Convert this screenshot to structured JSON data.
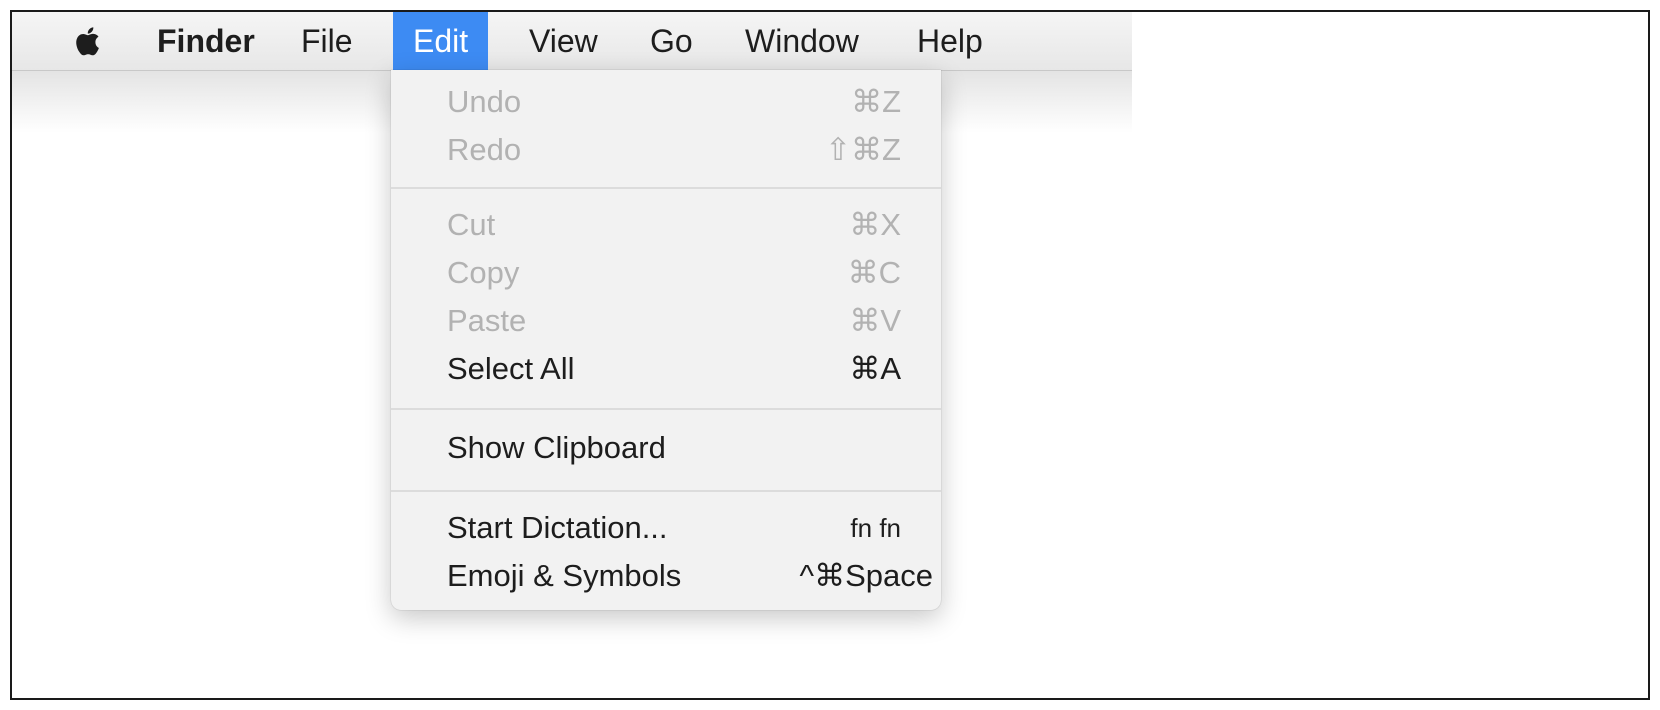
{
  "menubar": {
    "apple_icon": "apple-icon",
    "titles": [
      "Finder",
      "File",
      "Edit",
      "View",
      "Go",
      "Window",
      "Help"
    ],
    "active_index": 2,
    "active_color": "#3d8bf3"
  },
  "edit_menu": {
    "items": [
      {
        "label": "Undo",
        "shortcut": "⌘Z",
        "enabled": false
      },
      {
        "label": "Redo",
        "shortcut": "⇧⌘Z",
        "enabled": false
      },
      {
        "label": "Cut",
        "shortcut": "⌘X",
        "enabled": false
      },
      {
        "label": "Copy",
        "shortcut": "⌘C",
        "enabled": false
      },
      {
        "label": "Paste",
        "shortcut": "⌘V",
        "enabled": false
      },
      {
        "label": "Select All",
        "shortcut": "⌘A",
        "enabled": true
      },
      {
        "label": "Show Clipboard",
        "shortcut": "",
        "enabled": true
      },
      {
        "label": "Start Dictation...",
        "shortcut": "fn fn",
        "enabled": true
      },
      {
        "label": "Emoji & Symbols",
        "shortcut": "^⌘Space",
        "enabled": true
      }
    ]
  }
}
